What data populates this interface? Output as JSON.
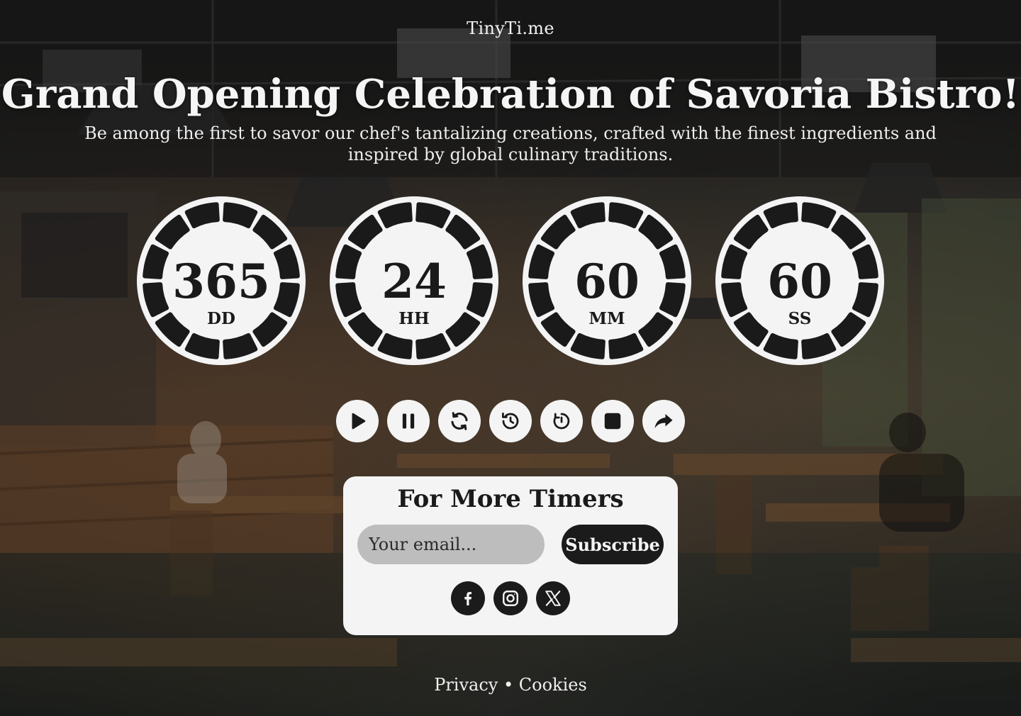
{
  "brand": "TinyTi.me",
  "headline": "Grand Opening Celebration of Savoria Bistro!",
  "subheadline": "Be among the first to savor our chef's tantalizing creations, crafted with the finest ingredients and inspired by global culinary traditions.",
  "countdown": [
    {
      "value": "365",
      "unit": "DD"
    },
    {
      "value": "24",
      "unit": "HH"
    },
    {
      "value": "60",
      "unit": "MM"
    },
    {
      "value": "60",
      "unit": "SS"
    }
  ],
  "controls": [
    {
      "icon": "play-icon"
    },
    {
      "icon": "pause-icon"
    },
    {
      "icon": "refresh-icon"
    },
    {
      "icon": "history-icon"
    },
    {
      "icon": "timer-reset-icon"
    },
    {
      "icon": "stop-icon"
    },
    {
      "icon": "share-icon"
    }
  ],
  "newsletter": {
    "title": "For More Timers",
    "email_placeholder": "Your email...",
    "subscribe_label": "Subscribe"
  },
  "social": [
    {
      "icon": "facebook-icon"
    },
    {
      "icon": "instagram-icon"
    },
    {
      "icon": "x-icon"
    }
  ],
  "footer": {
    "privacy": "Privacy",
    "separator": "•",
    "cookies": "Cookies"
  },
  "colors": {
    "dial_face": "#f4f4f4",
    "dial_ink": "#1a1a1a",
    "panel": "#f4f4f4",
    "button_dark": "#1b1b1b",
    "input_bg": "#bdbdbd"
  }
}
